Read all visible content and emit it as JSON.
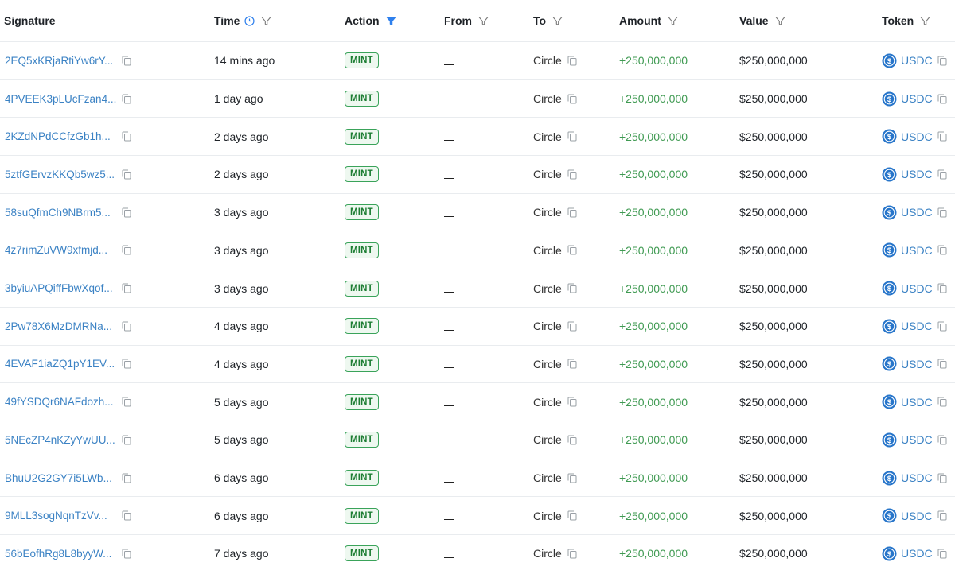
{
  "columns": {
    "signature": "Signature",
    "time": "Time",
    "action": "Action",
    "from": "From",
    "to": "To",
    "amount": "Amount",
    "value": "Value",
    "token": "Token"
  },
  "colors": {
    "link": "#3b82c4",
    "amount_positive": "#3f9a52",
    "mint_border": "#3aa35a",
    "active_filter": "#2f80ed"
  },
  "icons": {
    "filter": "filter-funnel-icon",
    "clock": "clock-icon",
    "copy": "copy-icon",
    "token": "usdc-coin-icon"
  },
  "rows": [
    {
      "signature": "2EQ5xKRjaRtiYw6rY...",
      "time": "14 mins ago",
      "action": "MINT",
      "from": "__",
      "to": "Circle",
      "amount": "+250,000,000",
      "value": "$250,000,000",
      "token": "USDC"
    },
    {
      "signature": "4PVEEK3pLUcFzan4...",
      "time": "1 day ago",
      "action": "MINT",
      "from": "__",
      "to": "Circle",
      "amount": "+250,000,000",
      "value": "$250,000,000",
      "token": "USDC"
    },
    {
      "signature": "2KZdNPdCCfzGb1h...",
      "time": "2 days ago",
      "action": "MINT",
      "from": "__",
      "to": "Circle",
      "amount": "+250,000,000",
      "value": "$250,000,000",
      "token": "USDC"
    },
    {
      "signature": "5ztfGErvzKKQb5wz5...",
      "time": "2 days ago",
      "action": "MINT",
      "from": "__",
      "to": "Circle",
      "amount": "+250,000,000",
      "value": "$250,000,000",
      "token": "USDC"
    },
    {
      "signature": "58suQfmCh9NBrm5...",
      "time": "3 days ago",
      "action": "MINT",
      "from": "__",
      "to": "Circle",
      "amount": "+250,000,000",
      "value": "$250,000,000",
      "token": "USDC"
    },
    {
      "signature": "4z7rimZuVW9xfmjd...",
      "time": "3 days ago",
      "action": "MINT",
      "from": "__",
      "to": "Circle",
      "amount": "+250,000,000",
      "value": "$250,000,000",
      "token": "USDC"
    },
    {
      "signature": "3byiuAPQiffFbwXqof...",
      "time": "3 days ago",
      "action": "MINT",
      "from": "__",
      "to": "Circle",
      "amount": "+250,000,000",
      "value": "$250,000,000",
      "token": "USDC"
    },
    {
      "signature": "2Pw78X6MzDMRNa...",
      "time": "4 days ago",
      "action": "MINT",
      "from": "__",
      "to": "Circle",
      "amount": "+250,000,000",
      "value": "$250,000,000",
      "token": "USDC"
    },
    {
      "signature": "4EVAF1iaZQ1pY1EV...",
      "time": "4 days ago",
      "action": "MINT",
      "from": "__",
      "to": "Circle",
      "amount": "+250,000,000",
      "value": "$250,000,000",
      "token": "USDC"
    },
    {
      "signature": "49fYSDQr6NAFdozh...",
      "time": "5 days ago",
      "action": "MINT",
      "from": "__",
      "to": "Circle",
      "amount": "+250,000,000",
      "value": "$250,000,000",
      "token": "USDC"
    },
    {
      "signature": "5NEcZP4nKZyYwUU...",
      "time": "5 days ago",
      "action": "MINT",
      "from": "__",
      "to": "Circle",
      "amount": "+250,000,000",
      "value": "$250,000,000",
      "token": "USDC"
    },
    {
      "signature": "BhuU2G2GY7i5LWb...",
      "time": "6 days ago",
      "action": "MINT",
      "from": "__",
      "to": "Circle",
      "amount": "+250,000,000",
      "value": "$250,000,000",
      "token": "USDC"
    },
    {
      "signature": "9MLL3sogNqnTzVv...",
      "time": "6 days ago",
      "action": "MINT",
      "from": "__",
      "to": "Circle",
      "amount": "+250,000,000",
      "value": "$250,000,000",
      "token": "USDC"
    },
    {
      "signature": "56bEofhRg8L8byyW...",
      "time": "7 days ago",
      "action": "MINT",
      "from": "__",
      "to": "Circle",
      "amount": "+250,000,000",
      "value": "$250,000,000",
      "token": "USDC"
    }
  ]
}
